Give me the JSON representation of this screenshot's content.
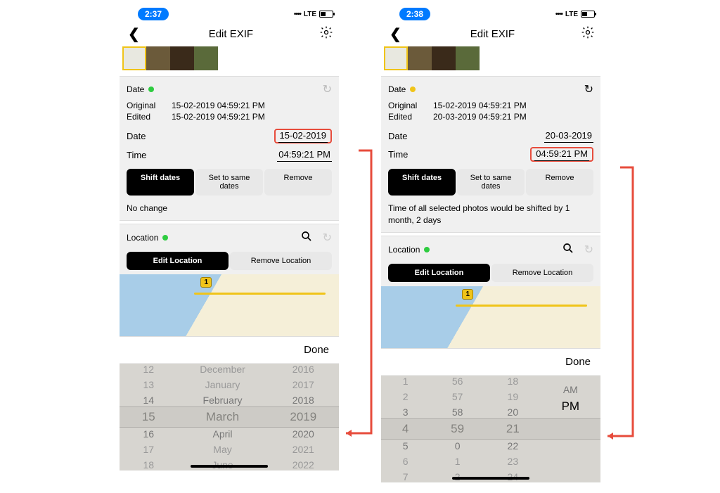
{
  "left": {
    "status": {
      "time": "2:37",
      "net": "LTE"
    },
    "nav": {
      "title": "Edit EXIF"
    },
    "date_section": {
      "label": "Date",
      "dot": "green",
      "original_k": "Original",
      "original_v": "15-02-2019 04:59:21 PM",
      "edited_k": "Edited",
      "edited_v": "15-02-2019 04:59:21 PM",
      "date_k": "Date",
      "date_v": "15-02-2019",
      "time_k": "Time",
      "time_v": "04:59:21 PM",
      "seg_shift": "Shift dates",
      "seg_same": "Set to same dates",
      "seg_remove": "Remove",
      "status_text": "No change"
    },
    "loc_section": {
      "label": "Location",
      "edit": "Edit Location",
      "remove": "Remove Location",
      "route": "1"
    },
    "done": "Done",
    "picker": {
      "col1": [
        "12",
        "13",
        "14",
        "15",
        "16",
        "17",
        "18"
      ],
      "col2": [
        "December",
        "January",
        "February",
        "March",
        "April",
        "May",
        "June"
      ],
      "col3": [
        "2016",
        "2017",
        "2018",
        "2019",
        "2020",
        "2021",
        "2022"
      ]
    }
  },
  "right": {
    "status": {
      "time": "2:38",
      "net": "LTE"
    },
    "nav": {
      "title": "Edit EXIF"
    },
    "date_section": {
      "label": "Date",
      "dot": "yellow",
      "original_k": "Original",
      "original_v": "15-02-2019 04:59:21 PM",
      "edited_k": "Edited",
      "edited_v": "20-03-2019 04:59:21 PM",
      "date_k": "Date",
      "date_v": "20-03-2019",
      "time_k": "Time",
      "time_v": "04:59:21 PM",
      "seg_shift": "Shift dates",
      "seg_same": "Set to same dates",
      "seg_remove": "Remove",
      "status_text": "Time of all selected photos would be shifted by 1 month, 2 days"
    },
    "loc_section": {
      "label": "Location",
      "edit": "Edit Location",
      "remove": "Remove Location",
      "route": "1"
    },
    "done": "Done",
    "picker": {
      "col1": [
        "1",
        "2",
        "3",
        "4",
        "5",
        "6",
        "7"
      ],
      "col2": [
        "56",
        "57",
        "58",
        "59",
        "0",
        "1",
        "2"
      ],
      "col3": [
        "18",
        "19",
        "20",
        "21",
        "22",
        "23",
        "24"
      ],
      "col4": [
        "",
        "",
        "AM",
        "PM",
        "",
        "",
        ""
      ]
    }
  }
}
